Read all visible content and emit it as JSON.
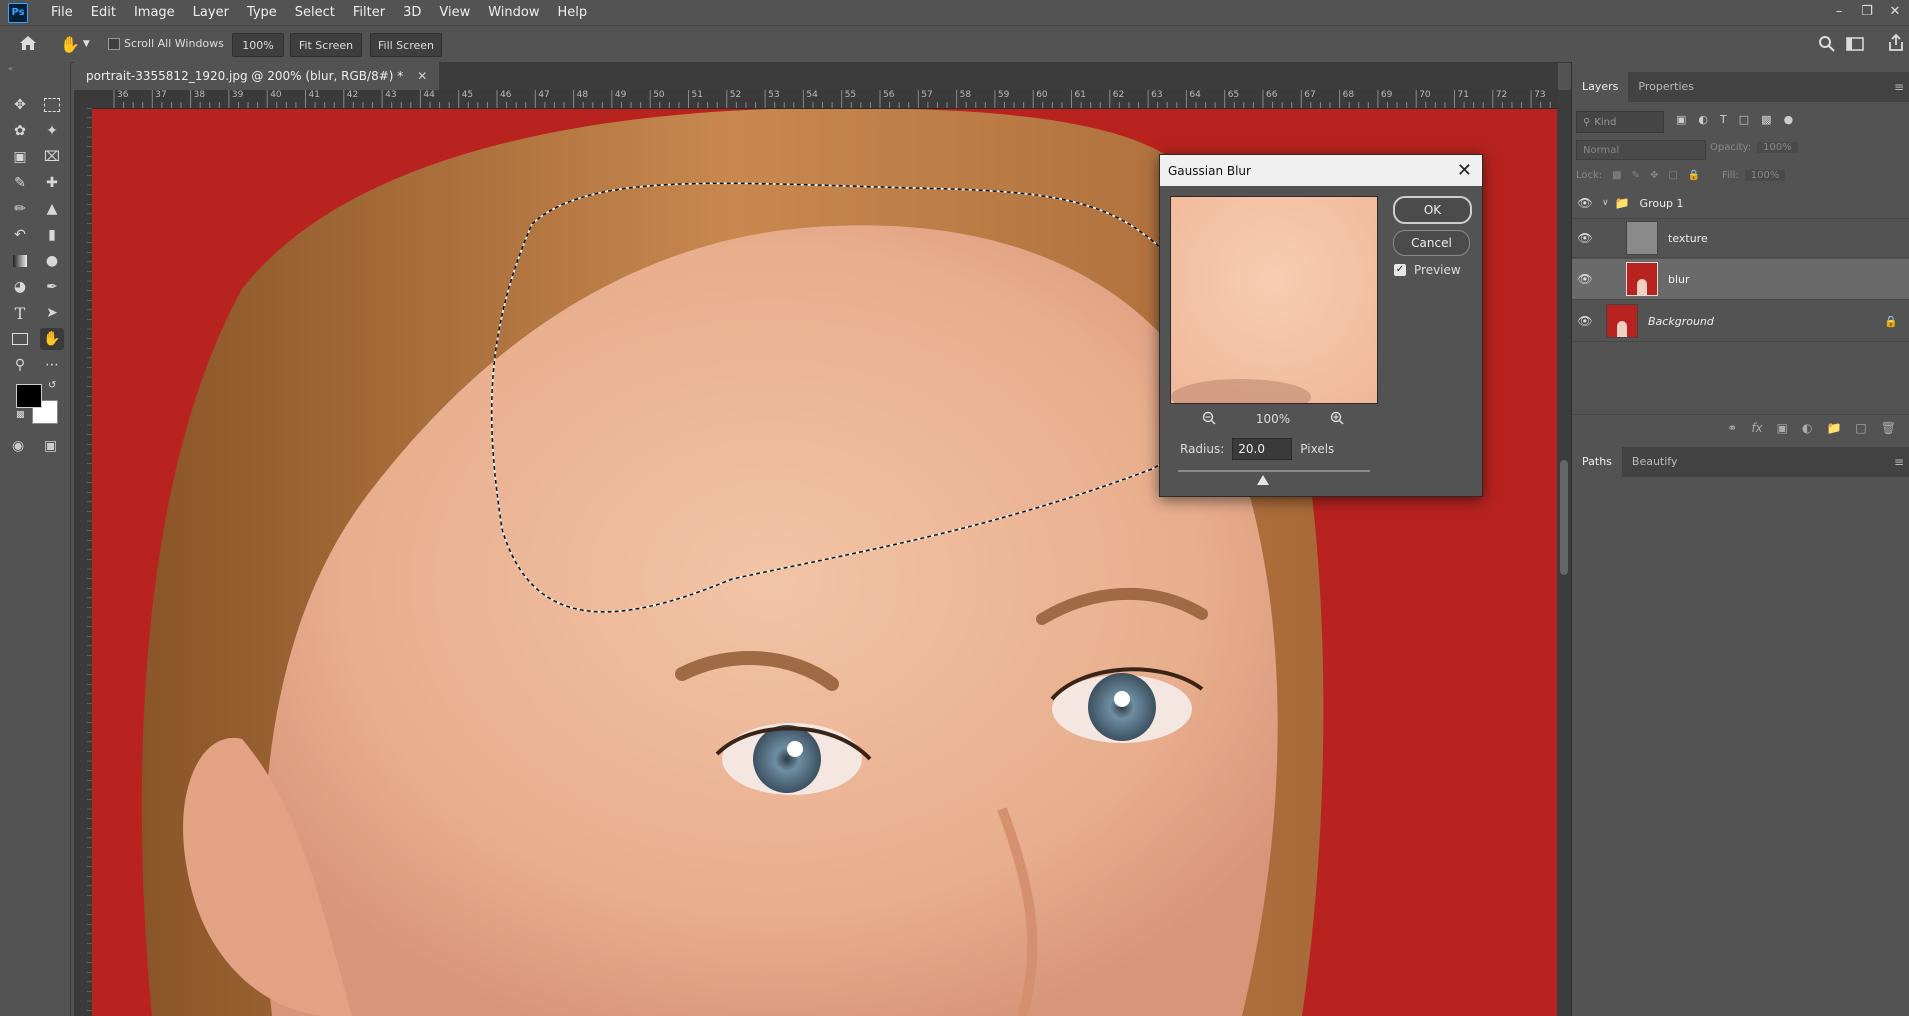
{
  "app": {
    "logo": "Ps"
  },
  "menu": [
    "File",
    "Edit",
    "Image",
    "Layer",
    "Type",
    "Select",
    "Filter",
    "3D",
    "View",
    "Window",
    "Help"
  ],
  "options": {
    "scroll_all_windows": "Scroll All Windows",
    "zoom_value": "100%",
    "fit_screen": "Fit Screen",
    "fill_screen": "Fill Screen"
  },
  "document": {
    "tab_title": "portrait-3355812_1920.jpg @ 200% (blur, RGB/8#) *",
    "ruler_ticks": [
      "36",
      "37",
      "38",
      "39",
      "40",
      "41",
      "42",
      "43",
      "44",
      "45",
      "46",
      "47",
      "48",
      "49",
      "50",
      "51",
      "52",
      "53",
      "54",
      "55",
      "56",
      "57",
      "58",
      "59",
      "60",
      "61",
      "62",
      "63",
      "64",
      "65",
      "66",
      "67",
      "68",
      "69",
      "70",
      "71",
      "72",
      "73"
    ]
  },
  "layers_panel": {
    "tabs": [
      "Layers",
      "Properties"
    ],
    "filter_placeholder": "Kind",
    "blend_mode": "Normal",
    "opacity_label": "Opacity:",
    "opacity_value": "100%",
    "lock_label": "Lock:",
    "fill_label": "Fill:",
    "fill_value": "100%",
    "layers": [
      {
        "name": "Group 1",
        "type": "group"
      },
      {
        "name": "texture",
        "type": "layer"
      },
      {
        "name": "blur",
        "type": "layer",
        "selected": true
      },
      {
        "name": "Background",
        "type": "background",
        "locked": true
      }
    ]
  },
  "paths_panel": {
    "tabs": [
      "Paths",
      "Beautify"
    ]
  },
  "gaussian_blur": {
    "title": "Gaussian Blur",
    "ok": "OK",
    "cancel": "Cancel",
    "preview_label": "Preview",
    "preview_checked": true,
    "zoom": "100%",
    "radius_label": "Radius:",
    "radius_value": "20.0",
    "radius_unit": "Pixels"
  },
  "colors": {
    "foreground": "#000000",
    "background": "#ffffff",
    "canvas_backdrop": "#b8231f"
  }
}
